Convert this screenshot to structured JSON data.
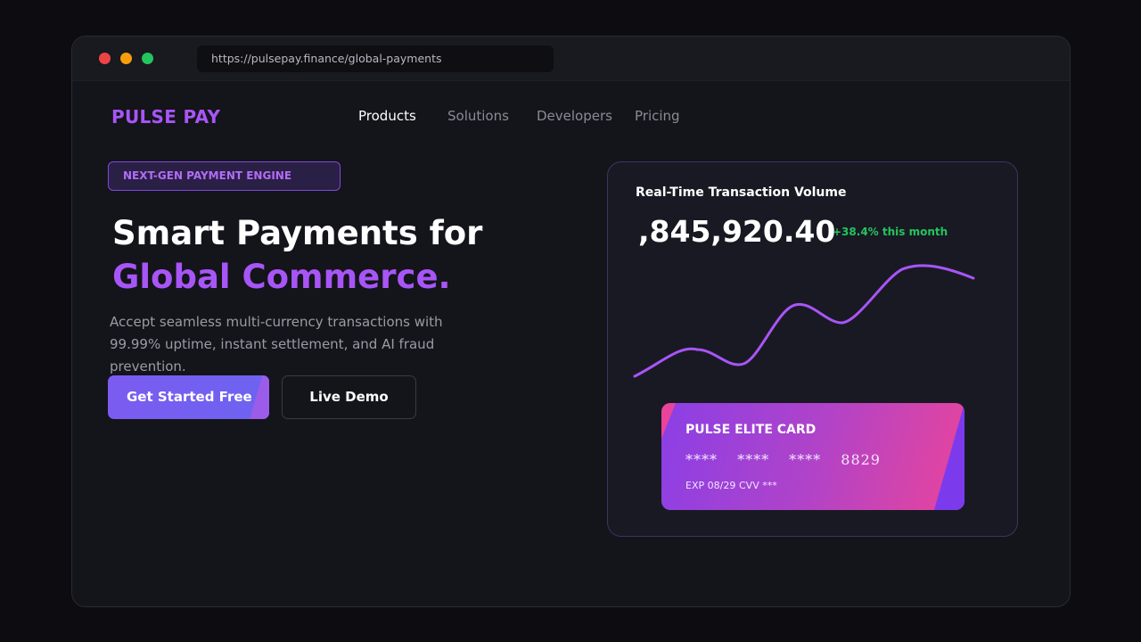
{
  "browser": {
    "url": "https://pulsepay.finance/global-payments"
  },
  "header": {
    "logo": "PULSE PAY",
    "nav": [
      "Products",
      "Solutions",
      "Developers",
      "Pricing"
    ],
    "active_nav": "Products"
  },
  "hero": {
    "badge": "NEXT-GEN PAYMENT ENGINE",
    "headline_line1": "Smart Payments for",
    "headline_line2": "Global Commerce.",
    "subtext": "Accept seamless multi-currency transactions with 99.99% uptime, instant settlement, and AI fraud prevention.",
    "cta_primary": "Get Started Free",
    "cta_secondary": "Live Demo"
  },
  "panel": {
    "title": "Real-Time Transaction Volume",
    "value": ",845,920.40",
    "change": "+38.4% this month",
    "line_color": "#a855f7"
  },
  "card": {
    "title": "PULSE ELITE CARD",
    "number": "**** **** **** 8829",
    "exp": "EXP 08/29",
    "cvv": "CVV ***"
  },
  "colors": {
    "accent": "#a855f7",
    "positive": "#22c55e",
    "card_gradient_start": "#8b3fe6",
    "card_gradient_end": "#e9449a"
  }
}
